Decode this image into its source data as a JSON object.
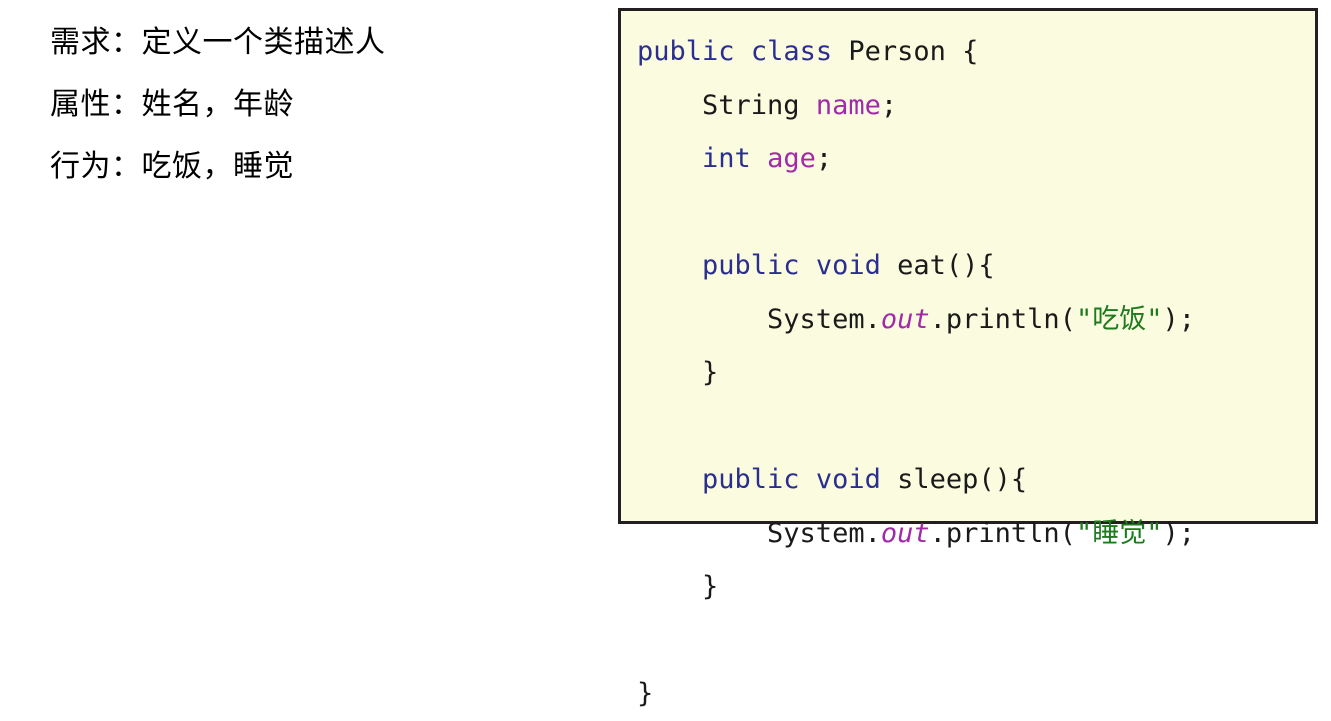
{
  "requirements": {
    "lines": [
      "需求：定义一个类描述人",
      "属性：姓名，年龄",
      "行为：吃饭，睡觉"
    ]
  },
  "code_panel": {
    "language": "java",
    "background_color": "#fbfbe0",
    "border_color": "#231f20",
    "syntax_colors": {
      "keyword": "#2a2f8f",
      "identifier": "#a02aa8",
      "string": "#1d7a1d",
      "plain": "#1a1a1a"
    },
    "plain_text": "public class Person {\n    String name;\n    int age;\n\n    public void eat(){\n        System.out.println(\"吃饭\");\n    }\n\n    public void sleep(){\n        System.out.println(\"睡觉\");\n    }\n\n}",
    "lines": [
      {
        "tokens": [
          {
            "t": "public",
            "c": "kw"
          },
          {
            "t": " ",
            "c": "plain"
          },
          {
            "t": "class",
            "c": "kw"
          },
          {
            "t": " Person {",
            "c": "plain"
          }
        ]
      },
      {
        "tokens": [
          {
            "t": "    String ",
            "c": "plain"
          },
          {
            "t": "name",
            "c": "id"
          },
          {
            "t": ";",
            "c": "plain"
          }
        ]
      },
      {
        "tokens": [
          {
            "t": "    ",
            "c": "plain"
          },
          {
            "t": "int",
            "c": "kw"
          },
          {
            "t": " ",
            "c": "plain"
          },
          {
            "t": "age",
            "c": "id"
          },
          {
            "t": ";",
            "c": "plain"
          }
        ]
      },
      {
        "tokens": [
          {
            "t": " ",
            "c": "plain"
          }
        ]
      },
      {
        "tokens": [
          {
            "t": "    ",
            "c": "plain"
          },
          {
            "t": "public",
            "c": "kw"
          },
          {
            "t": " ",
            "c": "plain"
          },
          {
            "t": "void",
            "c": "kw"
          },
          {
            "t": " eat(){",
            "c": "plain"
          }
        ]
      },
      {
        "tokens": [
          {
            "t": "        System.",
            "c": "plain"
          },
          {
            "t": "out",
            "c": "idi"
          },
          {
            "t": ".println(",
            "c": "plain"
          },
          {
            "t": "\"吃饭\"",
            "c": "str"
          },
          {
            "t": ");",
            "c": "plain"
          }
        ]
      },
      {
        "tokens": [
          {
            "t": "    }",
            "c": "plain"
          }
        ]
      },
      {
        "tokens": [
          {
            "t": " ",
            "c": "plain"
          }
        ]
      },
      {
        "tokens": [
          {
            "t": "    ",
            "c": "plain"
          },
          {
            "t": "public",
            "c": "kw"
          },
          {
            "t": " ",
            "c": "plain"
          },
          {
            "t": "void",
            "c": "kw"
          },
          {
            "t": " sleep(){",
            "c": "plain"
          }
        ]
      },
      {
        "tokens": [
          {
            "t": "        System.",
            "c": "plain"
          },
          {
            "t": "out",
            "c": "idi"
          },
          {
            "t": ".println(",
            "c": "plain"
          },
          {
            "t": "\"睡觉\"",
            "c": "str"
          },
          {
            "t": ");",
            "c": "plain"
          }
        ]
      },
      {
        "tokens": [
          {
            "t": "    }",
            "c": "plain"
          }
        ]
      },
      {
        "tokens": [
          {
            "t": " ",
            "c": "plain"
          }
        ]
      },
      {
        "tokens": [
          {
            "t": "}",
            "c": "plain"
          }
        ]
      }
    ]
  }
}
